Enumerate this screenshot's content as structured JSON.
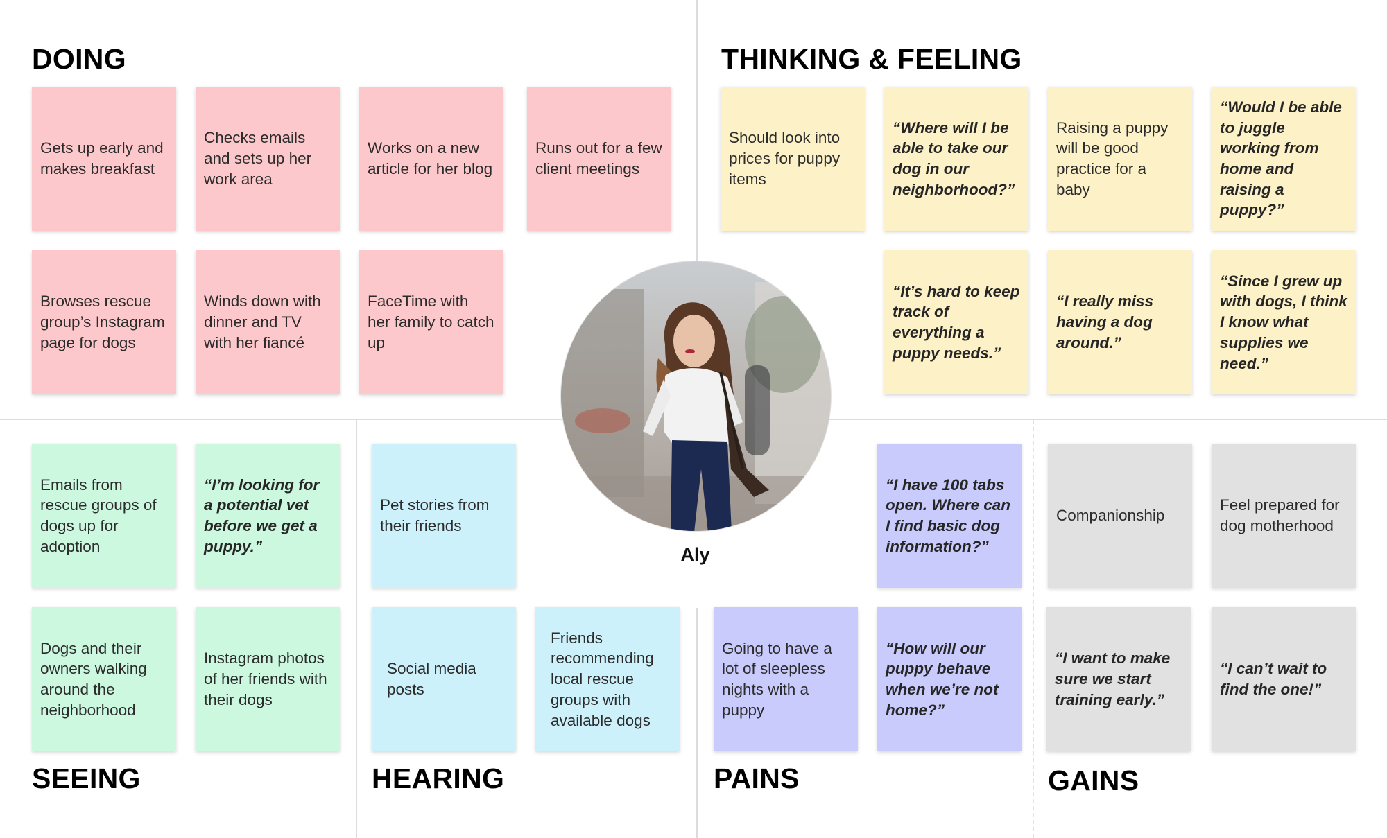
{
  "sections": {
    "doing": "DOING",
    "thinking": "THINKING & FEELING",
    "seeing": "SEEING",
    "hearing": "HEARING",
    "pains": "PAINS",
    "gains": "GAINS"
  },
  "persona": {
    "name": "Aly"
  },
  "notes": {
    "doing": [
      "Gets up early and makes breakfast",
      "Checks emails and sets up her work area",
      "Works on a new article for her blog",
      "Runs out for a few client meetings",
      "Browses rescue group’s Instagram page for dogs",
      "Winds down with dinner and TV with her fiancé",
      "FaceTime with her family to catch up"
    ],
    "thinking": [
      "Should look into prices for puppy items",
      "“Where will I be able to take our dog in our neighborhood?”",
      "Raising a puppy will be good practice for a baby",
      "“Would I be able to juggle working from home and raising a puppy?”",
      "“It’s hard to keep track of everything a puppy needs.”",
      "“I really miss having a dog around.”",
      "“Since I grew up with dogs, I think I know what supplies we need.”"
    ],
    "seeing": [
      "Emails from rescue groups of dogs up for adoption",
      "“I’m looking for a potential vet before we get a puppy.”",
      "Dogs and their owners walking around the neighborhood",
      "Instagram photos of her friends with their dogs"
    ],
    "hearing": [
      "Pet stories from their friends",
      "Social media posts",
      "Friends recommending local rescue groups with available dogs"
    ],
    "pains": [
      "“I have 100 tabs open. Where can I find basic dog information?”",
      "Going to have a lot of sleepless nights with a puppy",
      "“How will our puppy behave when we’re not home?”"
    ],
    "gains": [
      "Companionship",
      "Feel prepared for dog motherhood",
      "“I want to make sure we start training early.”",
      "“I can’t wait to find the one!”"
    ]
  },
  "colors": {
    "doing": "#fdc8cb",
    "thinking": "#fdf1c8",
    "seeing": "#ccf8e0",
    "hearing": "#cdf1fb",
    "pains": "#c9cbfd",
    "gains": "#e1e1e1"
  }
}
